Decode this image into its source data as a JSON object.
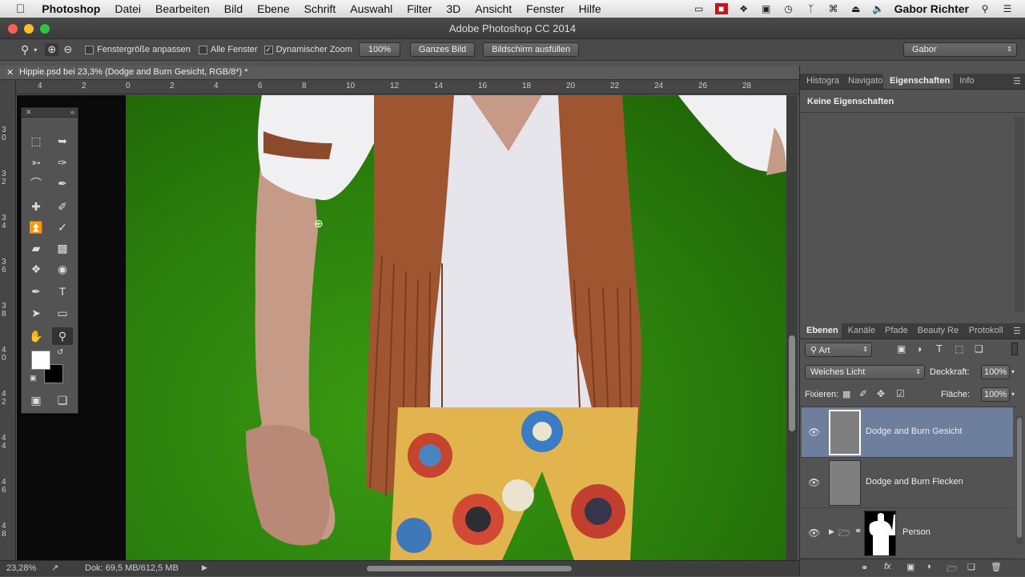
{
  "menubar": {
    "apple": "",
    "app": "Photoshop",
    "items": [
      "Datei",
      "Bearbeiten",
      "Bild",
      "Ebene",
      "Schrift",
      "Auswahl",
      "Filter",
      "3D",
      "Ansicht",
      "Fenster",
      "Hilfe"
    ],
    "user": "Gabor Richter"
  },
  "window": {
    "title": "Adobe Photoshop CC 2014"
  },
  "options": {
    "fit_window": "Fenstergröße anpassen",
    "all_windows": "Alle Fenster",
    "dynamic_zoom": "Dynamischer Zoom",
    "zoom_value": "100%",
    "whole_image": "Ganzes Bild",
    "fill_screen": "Bildschirm ausfüllen",
    "workspace": "Gabor"
  },
  "document": {
    "tab_title": "Hippie.psd bei 23,3% (Dodge and Burn Gesicht, RGB/8*) *",
    "zoom": "23,28%",
    "doc_size": "Dok: 69,5 MB/612,5 MB"
  },
  "ruler": {
    "top": [
      "4",
      "2",
      "0",
      "2",
      "4",
      "6",
      "8",
      "10",
      "12",
      "14",
      "16",
      "18",
      "20",
      "22",
      "24",
      "26",
      "28"
    ],
    "left": [
      "3\n0",
      "3\n2",
      "3\n4",
      "3\n6",
      "3\n8",
      "4\n0",
      "4\n2",
      "4\n4",
      "4\n6",
      "4\n8"
    ]
  },
  "properties_panel": {
    "tabs": [
      "Histogra",
      "Navigato",
      "Eigenschaften",
      "Info"
    ],
    "active_tab": "Eigenschaften",
    "content": "Keine Eigenschaften"
  },
  "layers_panel": {
    "tabs": [
      "Ebenen",
      "Kanäle",
      "Pfade",
      "Beauty Re",
      "Protokoll"
    ],
    "filter": "Art",
    "blend_mode": "Weiches Licht",
    "opacity_label": "Deckkraft:",
    "opacity": "100%",
    "lock_label": "Fixieren:",
    "fill_label": "Fläche:",
    "fill": "100%",
    "layers": [
      {
        "name": "Dodge and Burn Gesicht",
        "selected": true
      },
      {
        "name": "Dodge and Burn Flecken",
        "selected": false
      },
      {
        "name": "Person",
        "selected": false
      }
    ],
    "footer_fx": "fx"
  },
  "colors": {
    "accent_selected": "#6d7f9c",
    "green_screen": "#2a7d0c"
  }
}
